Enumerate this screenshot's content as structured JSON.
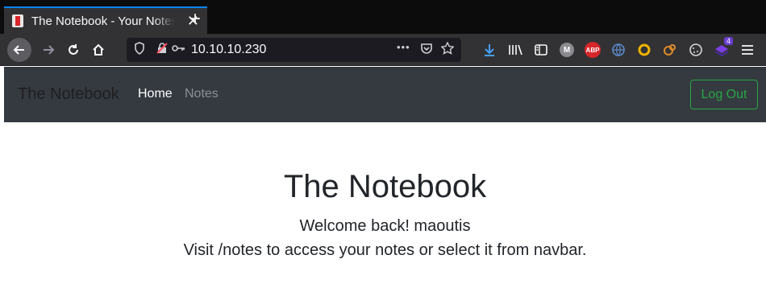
{
  "browser": {
    "tab_title": "The Notebook - Your Notes",
    "tab_close": "✕",
    "new_tab": "+",
    "url": "10.10.10.230",
    "url_dots": "•••",
    "extension_badge": "4",
    "abp_label": "ABP",
    "m_label": "M"
  },
  "navbar": {
    "brand": "The Notebook",
    "links": [
      {
        "label": "Home"
      },
      {
        "label": "Notes"
      }
    ],
    "logout_label": "Log Out"
  },
  "main": {
    "title": "The Notebook",
    "welcome": "Welcome back! maoutis",
    "hint": "Visit /notes to access your notes or select it from navbar."
  }
}
